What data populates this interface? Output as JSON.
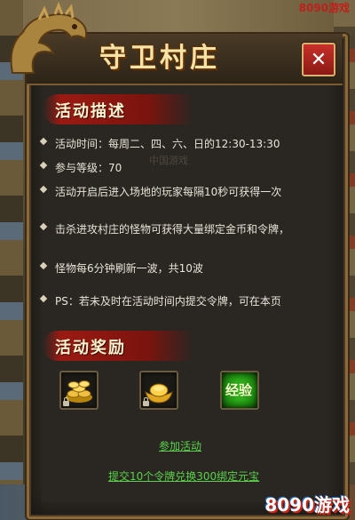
{
  "site_header": "8090游戏",
  "window": {
    "title": "守卫村庄",
    "close_icon": "close-icon"
  },
  "description": {
    "header": "活动描述",
    "items": [
      "活动时间：每周二、四、六、日的12:30-13:30",
      "参与等级：70",
      "活动开启后进入场地的玩家每隔10秒可获得一次",
      "击杀进攻村庄的怪物可获得大量绑定金币和令牌，",
      "怪物每6分钟刷新一波，共10波",
      "PS：若未及时在活动时间内提交令牌，可在本页"
    ],
    "faded_text": "中国游戏"
  },
  "rewards": {
    "header": "活动奖励",
    "items": [
      {
        "icon": "gold-coins-icon",
        "label": ""
      },
      {
        "icon": "gold-ingot-icon",
        "label": ""
      },
      {
        "icon": "experience-icon",
        "label": "经验"
      }
    ]
  },
  "actions": {
    "join": "参加活动",
    "exchange": "提交10个令牌兑换300绑定元宝"
  },
  "watermark": "8090游戏",
  "colors": {
    "panel_bg": "#2c2823",
    "gold": "#f4e4a8",
    "link_green": "#5ad24a",
    "section_red": "#9a1a12"
  }
}
